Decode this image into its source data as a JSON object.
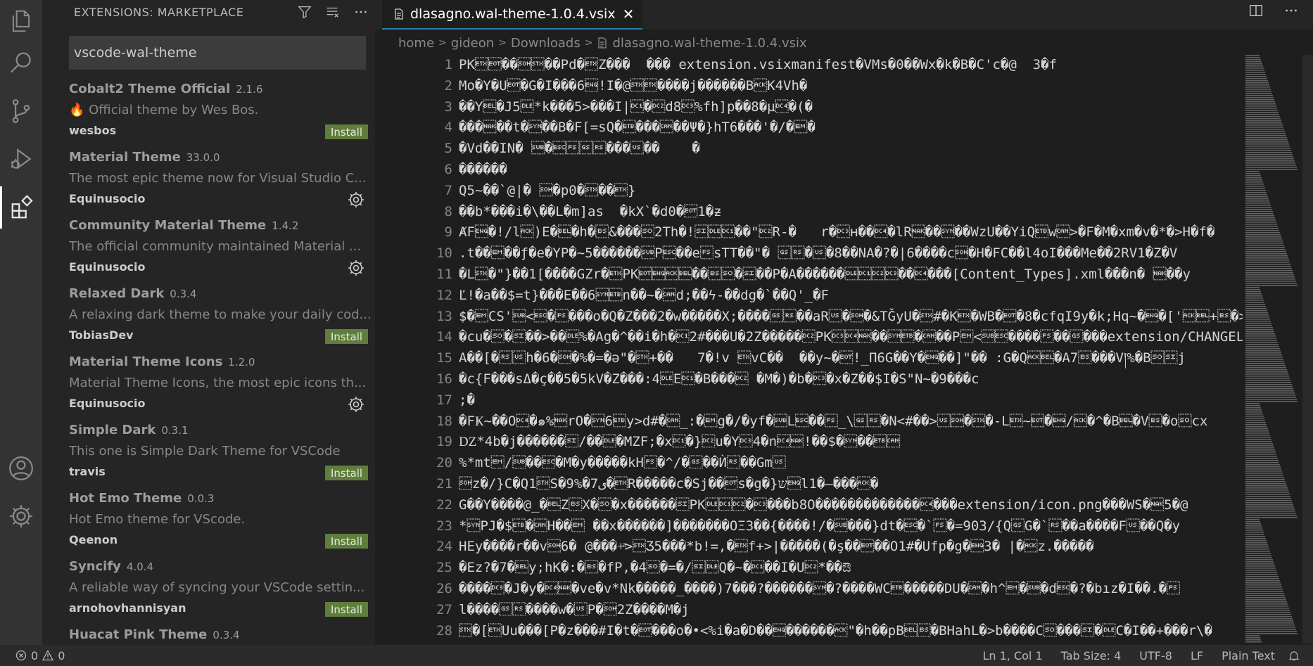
{
  "sidebar": {
    "title": "EXTENSIONS: MARKETPLACE",
    "search_value": "vscode-wal-theme",
    "extensions": [
      {
        "name": "Cobalt2 Theme Official",
        "version": "2.1.6",
        "desc": "🔥 Official theme by Wes Bos.",
        "publisher": "wesbos",
        "action": "Install"
      },
      {
        "name": "Material Theme",
        "version": "33.0.0",
        "desc": "The most epic theme now for Visual Studio C...",
        "publisher": "Equinusocio",
        "action": "gear"
      },
      {
        "name": "Community Material Theme",
        "version": "1.4.2",
        "desc": "The official community maintained Material ...",
        "publisher": "Equinusocio",
        "action": "gear"
      },
      {
        "name": "Relaxed Dark",
        "version": "0.3.4",
        "desc": "A relaxing dark theme to make your daily cod...",
        "publisher": "TobiasDev",
        "action": "Install"
      },
      {
        "name": "Material Theme Icons",
        "version": "1.2.0",
        "desc": "Material Theme Icons, the most epic icons th...",
        "publisher": "Equinusocio",
        "action": "gear"
      },
      {
        "name": "Simple Dark",
        "version": "0.3.1",
        "desc": "This one is Simple Dark Theme for VSCode",
        "publisher": "travis",
        "action": "Install"
      },
      {
        "name": "Hot Emo Theme",
        "version": "0.0.3",
        "desc": "Hot Emo theme for VScode.",
        "publisher": "Qeenon",
        "action": "Install"
      },
      {
        "name": "Syncify",
        "version": "4.0.4",
        "desc": "A reliable way of syncing your VSCode settin...",
        "publisher": "arnohovhannisyan",
        "action": "Install"
      },
      {
        "name": "Huacat Pink Theme",
        "version": "0.3.4",
        "desc": "",
        "publisher": "",
        "action": "none"
      }
    ]
  },
  "editor": {
    "tab_title": "dlasagno.wal-theme-1.0.4.vsix",
    "breadcrumb": [
      "home",
      "gideon",
      "Downloads",
      "dlasagno.wal-theme-1.0.4.vsix"
    ],
    "lines": [
      "PK\u0003\u0004��\u0001\u0002��Pd�\u0003Z���  ��� extension.vsixmanifest�VMs�0��Wx�k�B�C'c�@  3�f",
      "Mo�Y�U\u0004�G�I���6\u0005!I�@\u0002\u0003����j������B\u0006K4Vh�",
      "��Y\u0007�J5\u0010*k���5>���I|\u0011�\u0012d8\u0013%fh]p��8�µ\u0014�(�",
      "���\u0015��t�\u0016��B�F[=sQ�\u0017���\u0018��Ψ�}hT6���'�/�\u0019�",
      "�Vd��IN� \u001a�\u001b\u001c\u001d\u001e���\u001f��    �",
      "������",
      "Q5~��`@|� \u0001�p0�\u0002��\u0003}",
      "��b*���i�\\��L�m]as  �kX`�d0�\u00041�ƶ",
      "ȺF\u0005�!/l\u0006)E�\u0007�h�\b&���\u000e2Th�!\u000f\u0010\u0011��\"\u0012R-�   r�\u0013ʜ��\u0014�lR\u0015��\u0016��WzU��YiQ\u0017w\u0018>�F�M�xm�v�*�>H�f�",
      ".t��\u0019��ƒ�e�YP�~5������\u001aP\u001b��e\u001csTT��\"� \u001d\u001e�\u001f�8��NA�?�|6����c\u0001�H�FC��l4oI���Me��2RV1�Z�V",
      "�L\u0002�\"}��1[����GZr�\u0003PK\u0004\u0005\u0006\u0007��\b\u000e�\u000f��P�A������\u0010\u0011\u0012\u0013��\u0014���[Content_Types].xml���n� \u0015��y",
      "Ľ!�a��$=t}���E��6\u0016\u0017n��~�\u0018d;��ϟ-��dg�`��Q'_�F",
      "$�\u0019CS'\u001a<\u001b�\u001c���o�Q�Z���2�w�����X;����\u001d\u001e��aR\u001f�\u0001�&TǦyU�\u0002#�K\u0003�WB�\u0004�8�cfqI9y�k;Hq~�\u0005�['\u0006\u0007+\b�>�",
      "�cu�\u000e�\u000f��>��\u0010%�Ag�^��i�h�\u00112#���U�2Z�����\u0012PK\u0013\u0014\u0015��\u0016\u0017�\u0018��P\u0019<\u001a\u001b����\u001c��\u001d���extension/CHANGEL",
      "A��[�\u001e\u001fh�6�\u0001�%�=�ə\"�\u0002+��   7�!v \u0003vC��  ��y~�\u0004!_П6G��Y�\u0005��]\"�� :G�Q\u0006\u0007�A7\b���V།%�B\u000e\u000fj",
      "�c{F���sΔ�ç��5�5kV�Z���:4\u0010E\u0011�B���\u0012 �M�)�b�\u0013�x�Z��$I�S\"N~�9���c",
      ";�",
      "�FҜ~��O\u0014�๑%\u0015rO�\u00166\u0017y>d#�\u0018_:�\u0019g�/�yf�\u001aL\u001b��\u001c_\\\u001d\u001e�N<#��>\u001f\u0001�\u0002�-L\u0003~\u0004�\u0005/\u0006�^�B\u0007�V\b�o\u000ecx",
      "Ǳ*4b�j������\u000f/��\u0010�MZF;�x\u0011�}\u0012u�Y\u00134�n\u0014\u0015!��$�\u0016��\u0017\u0018",
      "%*mt\u0019/\u001a��\u001b�M�y�����kH\u001c�^/�\u001d��Ѝ\u001e��Gm\u001f",
      "\u0001z�/}C�Q1\u0002S�9%�7ی�\u0003R�����c�Sj��\u0004s�g�}ש\u0005l1�—���\u0006�",
      "G��Y����@_�\u0007Z\bX�\u000e�x������\u000fPK\u0010\u0011\u0012�\u0013���b8O�������������\u0014���extension/icon.png���WS�\u00155�@",
      "*\u0016PJ�$\u0017�\u0018H��\u0019 ��x������]�������OΞ3��{����!/�\u001a���}dt�\u001b�`\u001c�=903/{Q\u001dG�`\u001e��a����F\u001f��Q�y",
      "HEy����r��v\u00016� @���+ͣ>\u0002Ʒ5���*b!=,�\u0003f+>|�����(�ş��\u0004��O1#�Ufp�g�\u00053� |�\u0006z.�����",
      "�Ez?�7�\u0007y;hK�:�\b�fP,�4\u000e�=�/\u000f\u0010Q�~�\u0011��I�U\u0012*��ಔ",
      "����\u0013�J�y�\u0014\u0015�ve�v*Nk�����_����)7���?������\u0016�?����WC\u0017�����DU�\u0018�h^\u0019�\u001a�d\u001b�?�bız�I��.�\u001c",
      "l����\u001d\u001e����w�\u001fP�\u00012Z����M�j",
      "\u0002�[\u0003Uu���[P�z���#I�t�\u0004���o�•<%i�a�D��\u0005������\u0006\"�h��pB\u0007\b�BHahL�>b����C\u000e���\u000f�\u0010C�I��+���r\\�"
    ]
  },
  "status": {
    "errors": "0",
    "warnings": "0",
    "position": "Ln 1, Col 1",
    "tab_size": "Tab Size: 4",
    "encoding": "UTF-8",
    "eol": "LF",
    "language": "Plain Text"
  }
}
